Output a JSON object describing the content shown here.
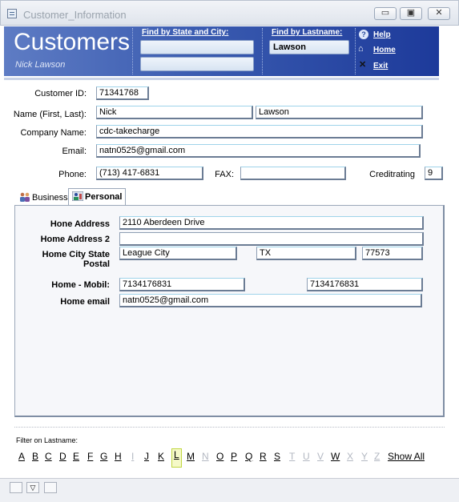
{
  "window": {
    "title": "Customer_Information",
    "controls": [
      "▭",
      "▣",
      "✕"
    ]
  },
  "header": {
    "title": "Customers",
    "subtitle": "Nick Lawson",
    "find_state_city_label": "Find by State and City:",
    "find_state_value": "",
    "find_city_value": "",
    "find_lastname_label": "Find by Lastname:",
    "find_lastname_value": "Lawson",
    "links": {
      "help": "Help",
      "home": "Home",
      "exit": "Exit"
    }
  },
  "form": {
    "customer_id": {
      "label": "Customer ID:",
      "value": "71341768"
    },
    "name": {
      "label": "Name (First, Last):",
      "first": "Nick",
      "last": "Lawson"
    },
    "company": {
      "label": "Company Name:",
      "value": "cdc-takecharge"
    },
    "email": {
      "label": "Email:",
      "value": "natn0525@gmail.com"
    },
    "phone": {
      "label": "Phone:",
      "value": "(713) 417-6831"
    },
    "fax": {
      "label": "FAX:",
      "value": ""
    },
    "creditrating": {
      "label": "Creditrating",
      "value": "9"
    }
  },
  "tabs": [
    {
      "label": "Business",
      "active": false
    },
    {
      "label": "Personal",
      "active": true
    }
  ],
  "personal": {
    "address1": {
      "label": "Hone Address",
      "value": "2110 Aberdeen Drive"
    },
    "address2": {
      "label": "Home Address 2",
      "value": ""
    },
    "city_state_postal": {
      "label": "Home City State Postal",
      "city": "League City",
      "state": "TX",
      "postal": "77573"
    },
    "mobil": {
      "label": "Home - Mobil:",
      "mobil": "7134176831",
      "home": "7134176831"
    },
    "email": {
      "label": "Home email",
      "value": "natn0525@gmail.com"
    }
  },
  "filter": {
    "label": "Filter on Lastname:",
    "letters": [
      "A",
      "B",
      "C",
      "D",
      "E",
      "F",
      "G",
      "H",
      "I",
      "J",
      "K",
      "L",
      "M",
      "N",
      "O",
      "P",
      "Q",
      "R",
      "S",
      "T",
      "U",
      "V",
      "W",
      "X",
      "Y",
      "Z"
    ],
    "dimmed": [
      "I",
      "N",
      "T",
      "U",
      "V",
      "X",
      "Y",
      "Z"
    ],
    "selected": "L",
    "show_all": "Show All"
  },
  "colors": {
    "banner_start": "#5e7cc4",
    "banner_end": "#1d3a9a",
    "selected_letter_bg": "#f5f9c8"
  }
}
